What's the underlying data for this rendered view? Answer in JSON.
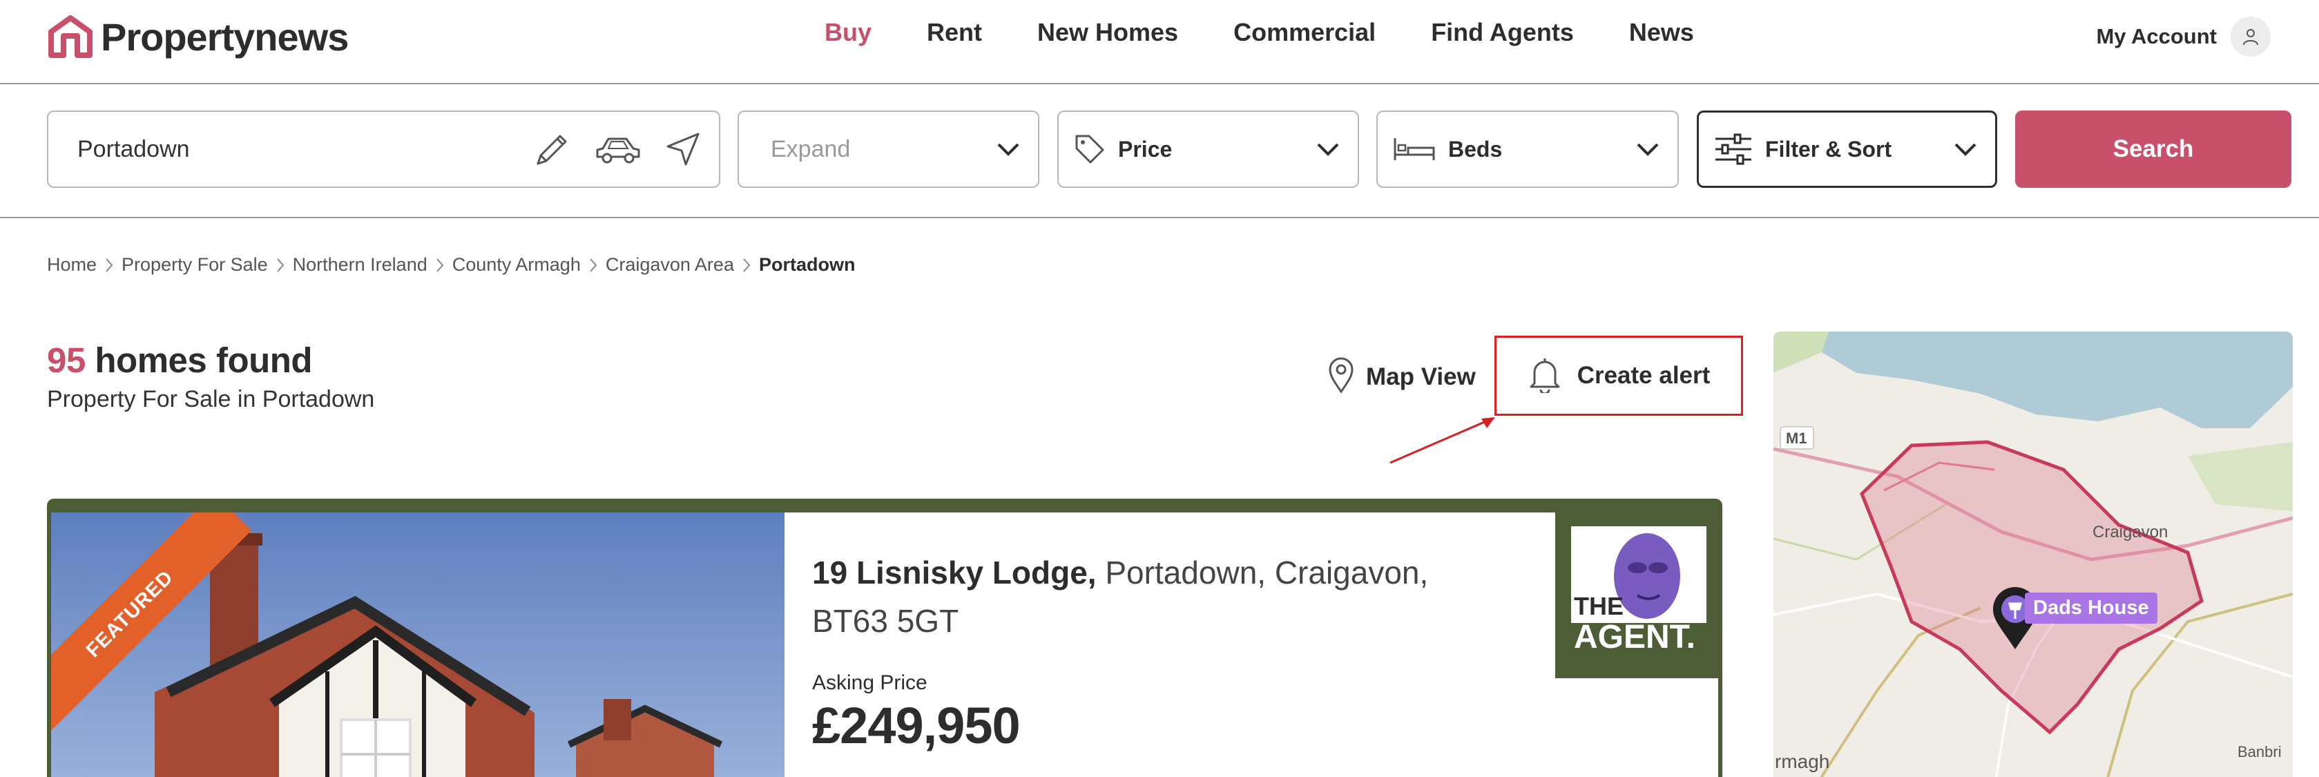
{
  "brand": {
    "name": "Propertynews",
    "accent_color": "#c8506a"
  },
  "nav": {
    "items": [
      {
        "label": "Buy",
        "active": true
      },
      {
        "label": "Rent",
        "active": false
      },
      {
        "label": "New Homes",
        "active": false
      },
      {
        "label": "Commercial",
        "active": false
      },
      {
        "label": "Find Agents",
        "active": false
      },
      {
        "label": "News",
        "active": false
      }
    ]
  },
  "account": {
    "label": "My Account",
    "icon": "user-icon"
  },
  "search": {
    "location_value": "Portadown",
    "location_icons": [
      "pencil-icon",
      "car-icon",
      "location-arrow-icon"
    ],
    "expand_placeholder": "Expand",
    "price_label": "Price",
    "beds_label": "Beds",
    "filter_label": "Filter & Sort",
    "search_button": "Search"
  },
  "breadcrumb": {
    "items": [
      "Home",
      "Property For Sale",
      "Northern Ireland",
      "County Armagh",
      "Craigavon Area",
      "Portadown"
    ]
  },
  "results": {
    "count": "95",
    "title_suffix": "homes found",
    "subtitle": "Property For Sale in Portadown",
    "map_view_label": "Map View",
    "create_alert_label": "Create alert"
  },
  "listing": {
    "badge": "FEATURED",
    "address_strong": "19 Lisnisky Lodge,",
    "address_rest": " Portadown, Craigavon, BT63 5GT",
    "price_label": "Asking Price",
    "price": "£249,950",
    "agent_logo_text_1": "THE",
    "agent_logo_text_2": "AGENT.",
    "card_color": "#4d5d36",
    "badge_color": "#e2612a"
  },
  "map": {
    "pin_label": "Dads House",
    "labels": {
      "road": "M1",
      "town1": "Craigavon",
      "town2": "rmagh",
      "town3": "Banbri"
    }
  }
}
